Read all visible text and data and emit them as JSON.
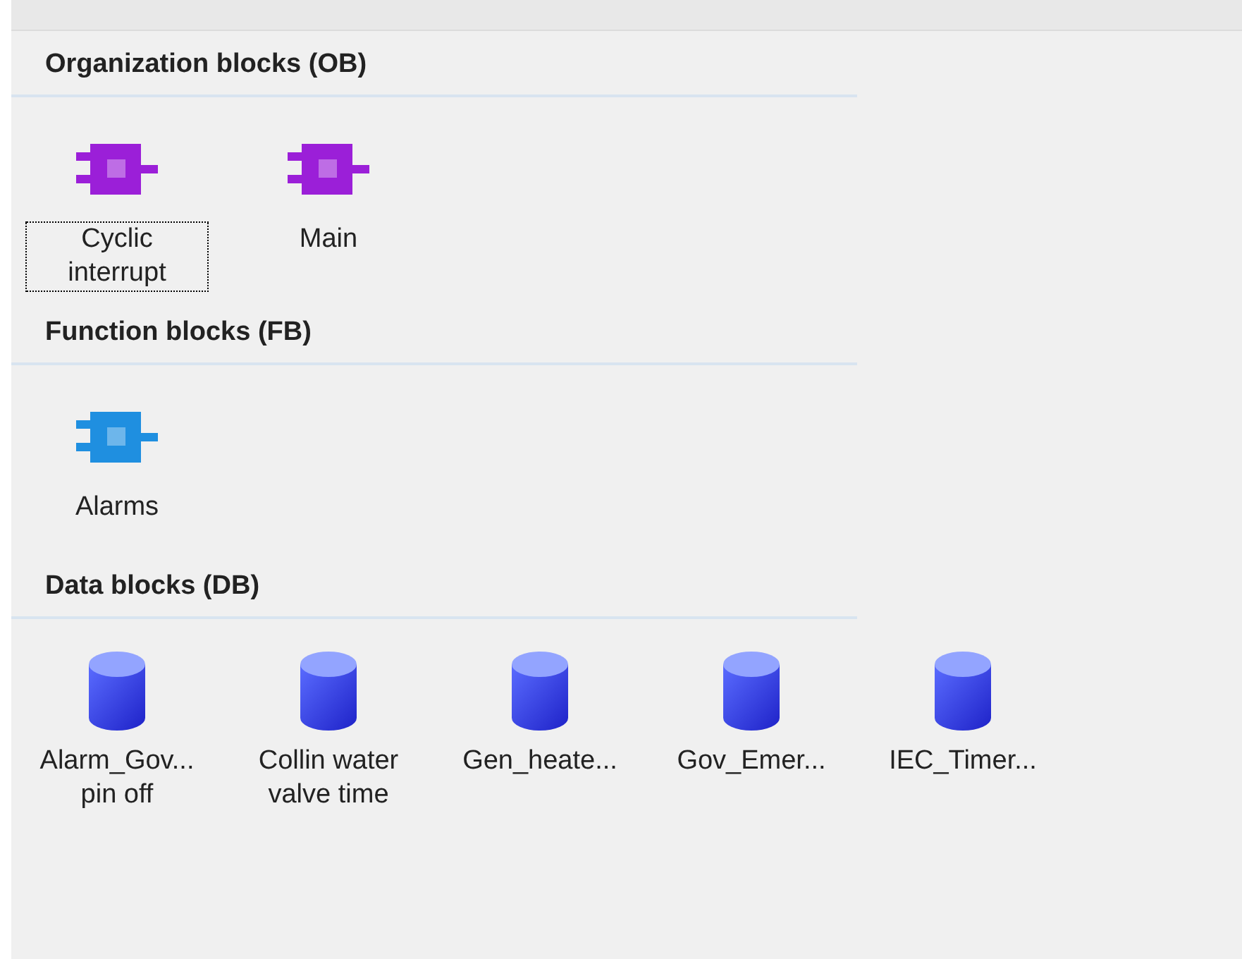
{
  "sections": [
    {
      "title": "Organization blocks (OB)",
      "kind": "ob",
      "items": [
        {
          "label": "Cyclic interrupt",
          "selected": true
        },
        {
          "label": "Main",
          "selected": false
        }
      ]
    },
    {
      "title": "Function blocks (FB)",
      "kind": "fb",
      "items": [
        {
          "label": "Alarms",
          "selected": false
        }
      ]
    },
    {
      "title": "Data blocks (DB)",
      "kind": "db",
      "items": [
        {
          "label": "Alarm_Gov... pin off",
          "selected": false
        },
        {
          "label": "Collin water valve time",
          "selected": false
        },
        {
          "label": "Gen_heate...",
          "selected": false
        },
        {
          "label": "Gov_Emer...",
          "selected": false
        },
        {
          "label": "IEC_Timer...",
          "selected": false
        }
      ]
    }
  ]
}
